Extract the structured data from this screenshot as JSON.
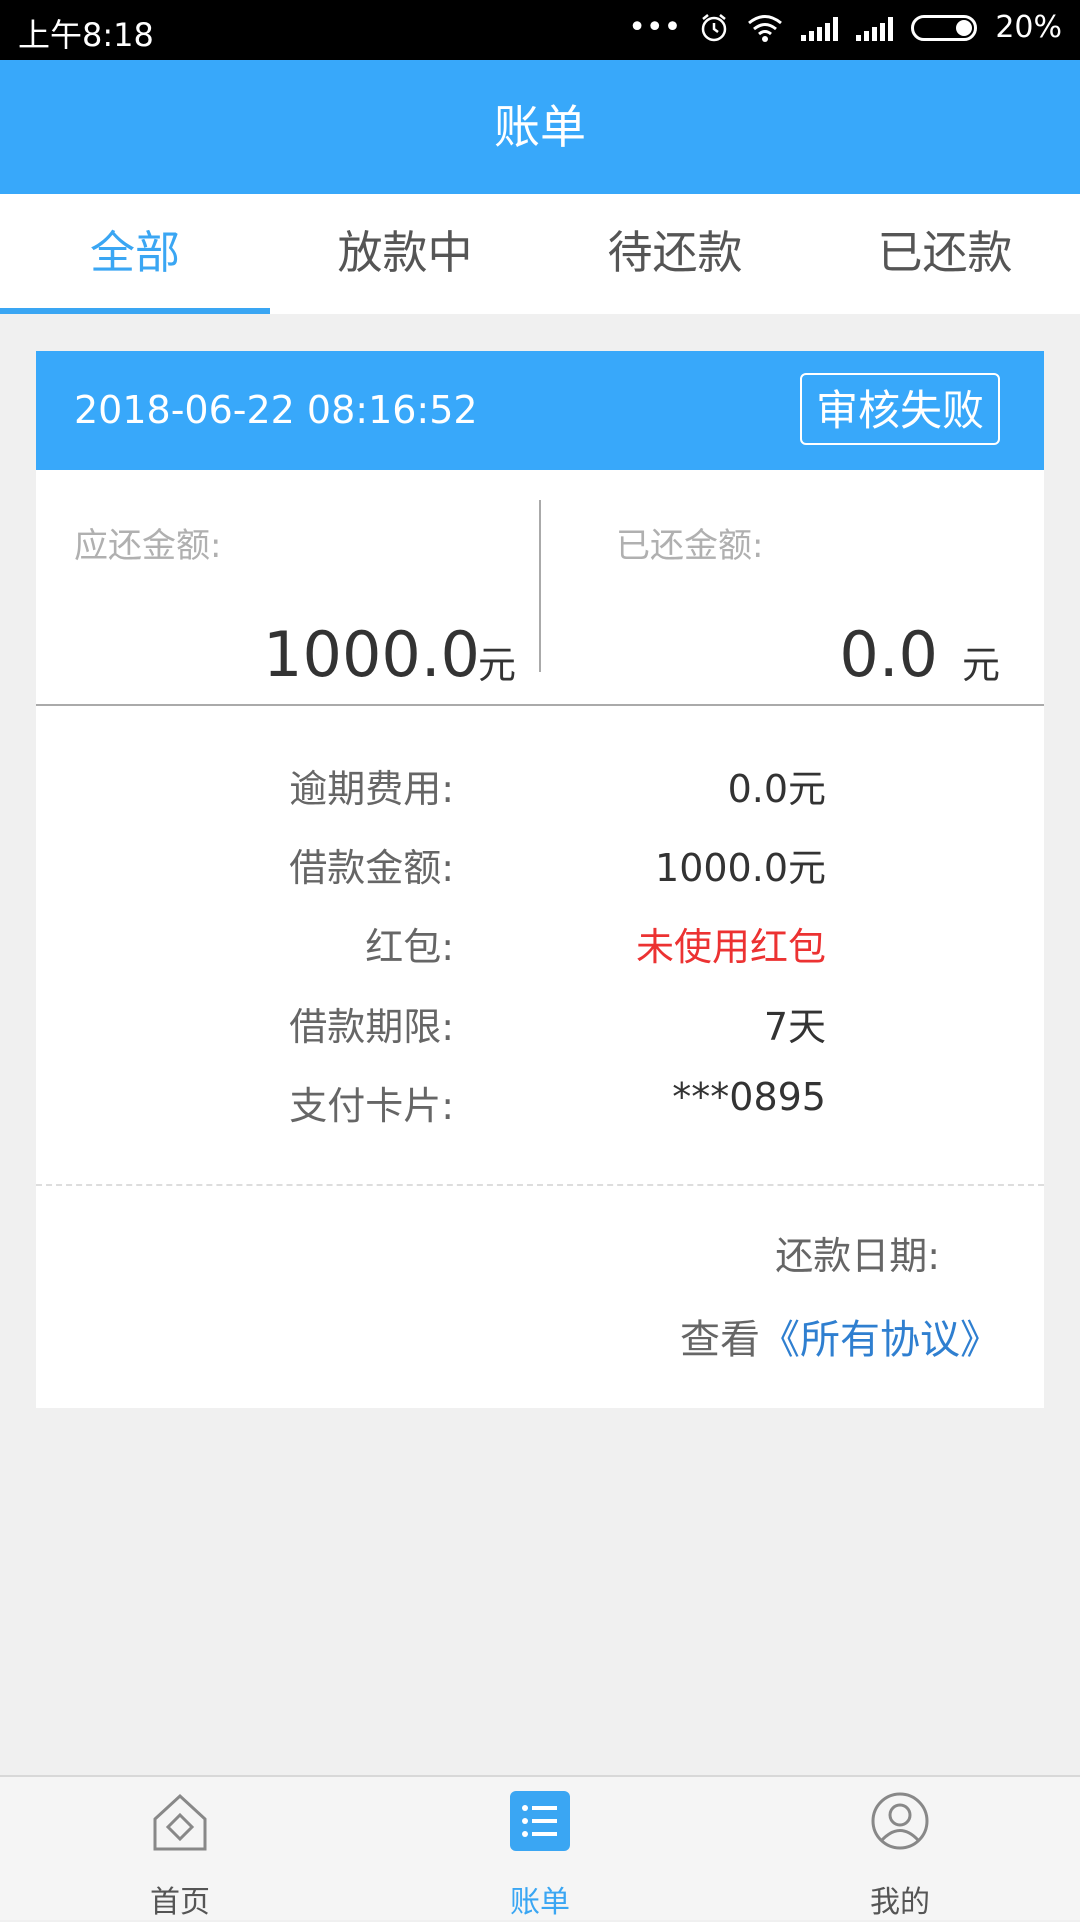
{
  "status_bar": {
    "time": "上午8:18",
    "battery": "20%"
  },
  "app_bar": {
    "title": "账单"
  },
  "tabs": [
    {
      "label": "全部",
      "active": true
    },
    {
      "label": "放款中",
      "active": false
    },
    {
      "label": "待还款",
      "active": false
    },
    {
      "label": "已还款",
      "active": false
    }
  ],
  "bill": {
    "datetime": "2018-06-22 08:16:52",
    "status": "审核失败",
    "due_label": "应还金额:",
    "due_value": "1000.0",
    "due_unit": "元",
    "paid_label": "已还金额:",
    "paid_value": "0.0",
    "paid_unit": "元",
    "details": [
      {
        "key": "逾期费用:",
        "value": "0.0元"
      },
      {
        "key": "借款金额:",
        "value": "1000.0元"
      },
      {
        "key": "红包:",
        "value": "未使用红包"
      },
      {
        "key": "借款期限:",
        "value": "7天"
      },
      {
        "key": "支付卡片:",
        "value": "***0895"
      }
    ],
    "repay_date_label": "还款日期:",
    "view_label": "查看",
    "agreement_link": "《所有协议》"
  },
  "bottom_nav": [
    {
      "label": "首页",
      "icon": "home-icon",
      "active": false
    },
    {
      "label": "账单",
      "icon": "bill-list-icon",
      "active": true
    },
    {
      "label": "我的",
      "icon": "user-icon",
      "active": false
    }
  ],
  "colors": {
    "primary": "#38a8fa",
    "tab_active": "#3aa6f3",
    "warning_red": "#ec3232",
    "link": "#2f7fd0"
  }
}
